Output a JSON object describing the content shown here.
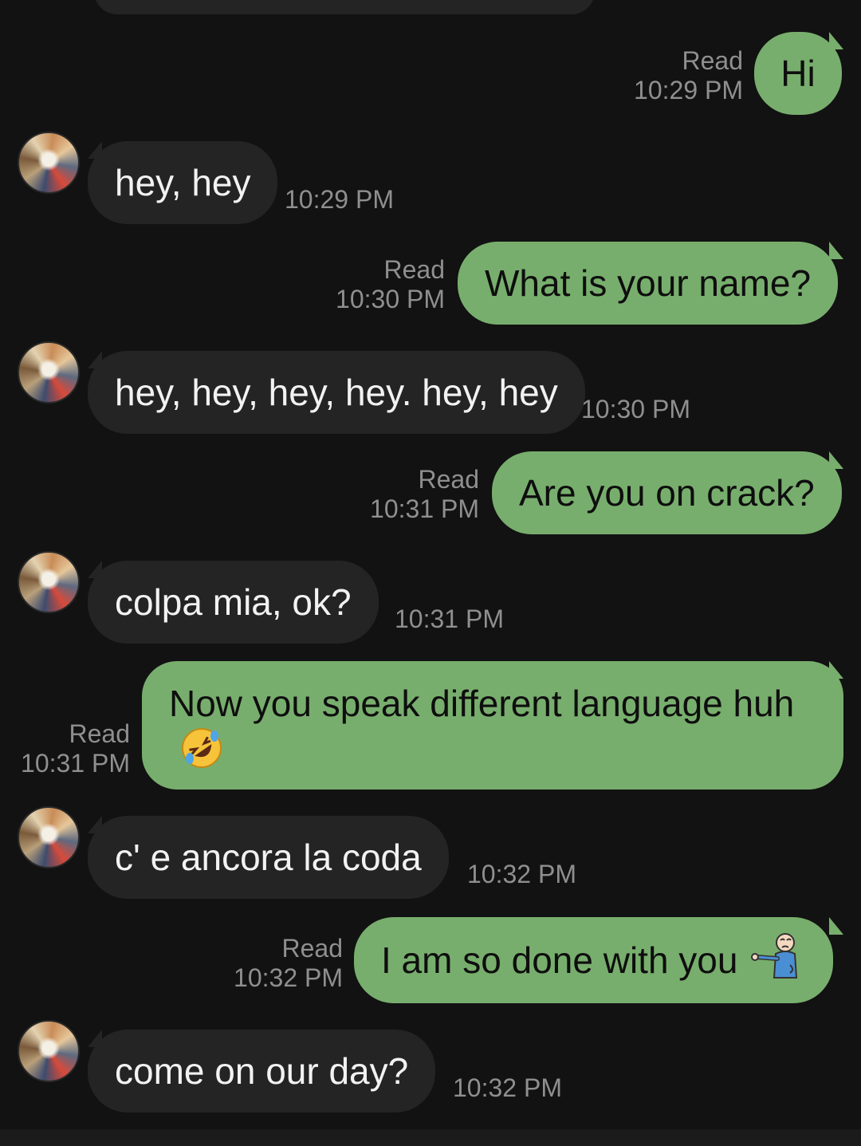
{
  "messages": [
    {
      "direction": "out",
      "text": "Hi",
      "status": "Read",
      "time": "10:29 PM"
    },
    {
      "direction": "in",
      "text": "hey, hey",
      "time": "10:29 PM"
    },
    {
      "direction": "out",
      "text": "What is your name?",
      "status": "Read",
      "time": "10:30 PM"
    },
    {
      "direction": "in",
      "text": "hey, hey, hey, hey. hey, hey",
      "time": "10:30 PM"
    },
    {
      "direction": "out",
      "text": "Are you on crack?",
      "status": "Read",
      "time": "10:31 PM"
    },
    {
      "direction": "in",
      "text": "colpa mia, ok?",
      "time": "10:31 PM"
    },
    {
      "direction": "out",
      "text": "Now you speak different language huh",
      "status": "Read",
      "time": "10:31 PM",
      "emoji": "rolling-on-floor-laughing-emoji"
    },
    {
      "direction": "in",
      "text": "c' e ancora la coda",
      "time": "10:32 PM"
    },
    {
      "direction": "out",
      "text": "I am so done with you",
      "status": "Read",
      "time": "10:32 PM",
      "emoji": "person-pointing-emoji"
    },
    {
      "direction": "in",
      "text": "come on our day?",
      "time": "10:32 PM"
    }
  ],
  "colors": {
    "background": "#121212",
    "incoming_bubble": "#242424",
    "outgoing_bubble": "#78ae6d",
    "meta_text": "#8f8f8f"
  }
}
